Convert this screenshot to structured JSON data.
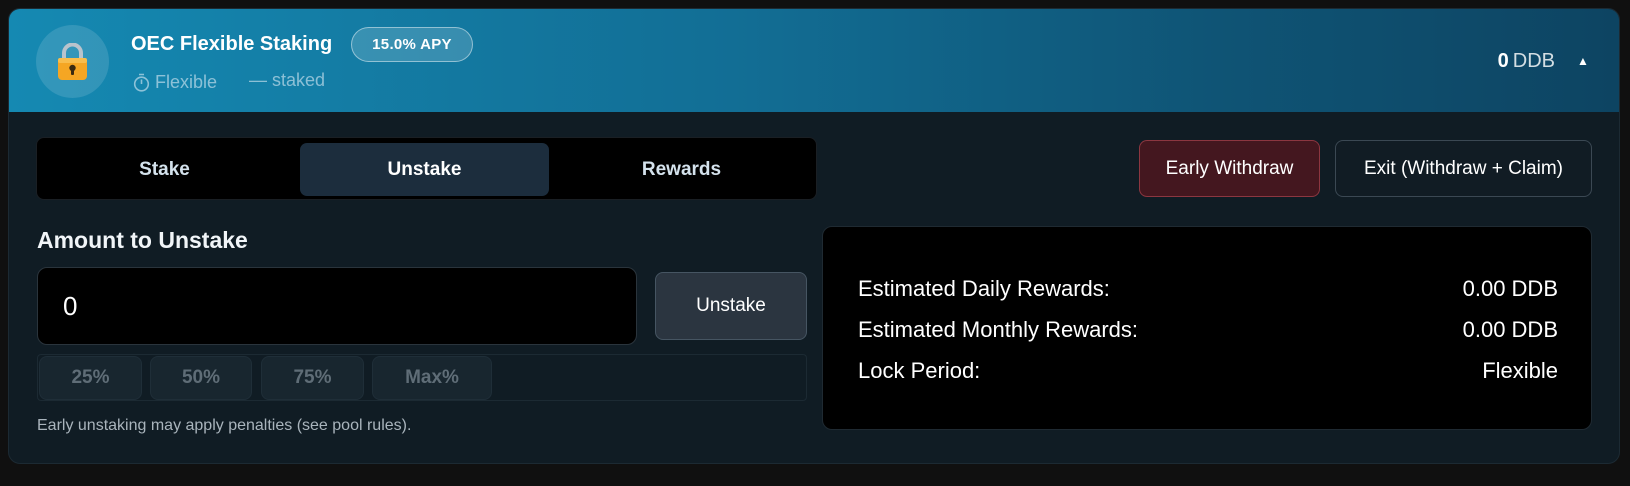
{
  "header": {
    "title": "OEC Flexible Staking",
    "apy_badge": "15.0% APY",
    "lock_type_icon": "stopwatch-icon",
    "lock_type": "Flexible",
    "staked_text": "— staked",
    "balance_amount": "0",
    "balance_unit": "DDB",
    "collapse_icon": "▲",
    "lock_icon": "padlock-icon"
  },
  "tabs": [
    {
      "label": "Stake",
      "active": false
    },
    {
      "label": "Unstake",
      "active": true
    },
    {
      "label": "Rewards",
      "active": false
    }
  ],
  "actions": {
    "early_withdraw": "Early Withdraw",
    "exit": "Exit (Withdraw + Claim)"
  },
  "unstake": {
    "label": "Amount to Unstake",
    "input_value": "0",
    "submit_label": "Unstake",
    "percent_options": [
      "25%",
      "50%",
      "75%",
      "Max%"
    ],
    "note": "Early unstaking may apply penalties (see pool rules)."
  },
  "stats": [
    {
      "label": "Estimated Daily Rewards:",
      "value": "0.00 DDB"
    },
    {
      "label": "Estimated Monthly Rewards:",
      "value": "0.00 DDB"
    },
    {
      "label": "Lock Period:",
      "value": "Flexible"
    }
  ],
  "colors": {
    "header_gradient_start": "#1589b2",
    "header_gradient_end": "#0d4462",
    "early_withdraw_bg": "#44171f",
    "early_withdraw_border": "#8c3640",
    "active_tab_bg": "#1c2d3d"
  }
}
